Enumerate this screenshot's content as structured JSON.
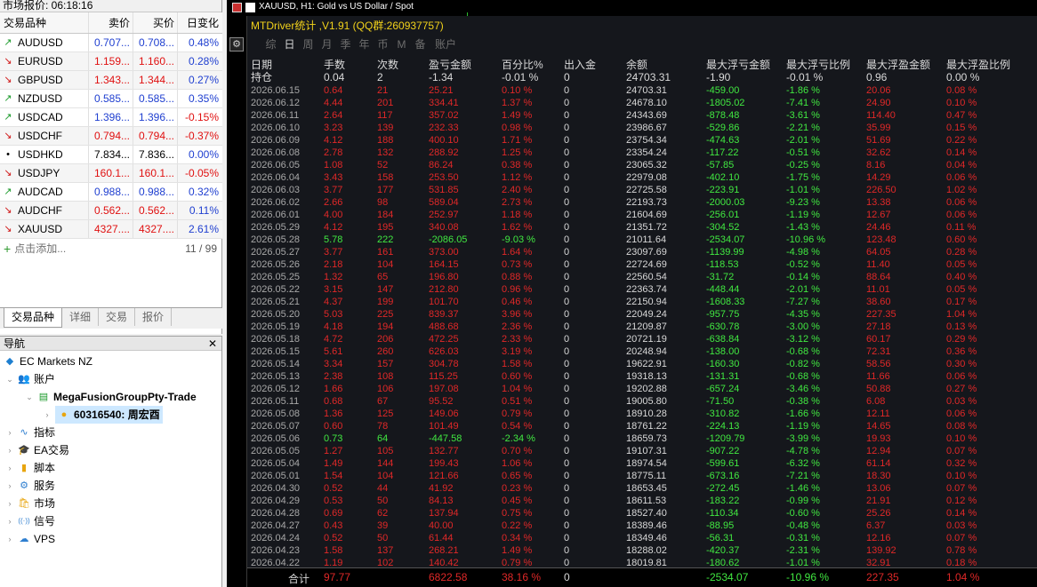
{
  "market_watch": {
    "title": "市场报价: 06:18:16",
    "headers": {
      "symbol": "交易品种",
      "bid": "卖价",
      "ask": "买价",
      "change": "日变化"
    },
    "rows": [
      {
        "symbol": "AUDUSD",
        "bid": "0.707...",
        "ask": "0.708...",
        "change": "0.48%",
        "dir": "up"
      },
      {
        "symbol": "EURUSD",
        "bid": "1.159...",
        "ask": "1.160...",
        "change": "0.28%",
        "dir": "down"
      },
      {
        "symbol": "GBPUSD",
        "bid": "1.343...",
        "ask": "1.344...",
        "change": "0.27%",
        "dir": "down"
      },
      {
        "symbol": "NZDUSD",
        "bid": "0.585...",
        "ask": "0.585...",
        "change": "0.35%",
        "dir": "up"
      },
      {
        "symbol": "USDCAD",
        "bid": "1.396...",
        "ask": "1.396...",
        "change": "-0.15%",
        "dir": "up"
      },
      {
        "symbol": "USDCHF",
        "bid": "0.794...",
        "ask": "0.794...",
        "change": "-0.37%",
        "dir": "down"
      },
      {
        "symbol": "USDHKD",
        "bid": "7.834...",
        "ask": "7.836...",
        "change": "0.00%",
        "dir": "none"
      },
      {
        "symbol": "USDJPY",
        "bid": "160.1...",
        "ask": "160.1...",
        "change": "-0.05%",
        "dir": "down"
      },
      {
        "symbol": "AUDCAD",
        "bid": "0.988...",
        "ask": "0.988...",
        "change": "0.32%",
        "dir": "up"
      },
      {
        "symbol": "AUDCHF",
        "bid": "0.562...",
        "ask": "0.562...",
        "change": "0.11%",
        "dir": "down"
      },
      {
        "symbol": "XAUUSD",
        "bid": "4327....",
        "ask": "4327....",
        "change": "2.61%",
        "dir": "down"
      }
    ],
    "add_label": "点击添加...",
    "count": "11 / 99",
    "tabs": [
      "交易品种",
      "详细",
      "交易",
      "报价"
    ]
  },
  "navigator": {
    "title": "导航",
    "broker": "EC Markets NZ",
    "accounts_label": "账户",
    "server": "MegaFusionGroupPty-Trade",
    "account": "60316540: 周宏酉",
    "items": [
      "指标",
      "EA交易",
      "脚本",
      "服务",
      "市场",
      "信号",
      "VPS"
    ]
  },
  "chart": {
    "header": "XAUUSD, H1:  Gold vs US Dollar / Spot",
    "panel_title": "MTDriver统计 ,V1.91 (QQ群:260937757)",
    "tabs": [
      "综",
      "日",
      "周",
      "月",
      "季",
      "年",
      "币",
      "M",
      "备",
      "账户"
    ],
    "active_tab": "日",
    "side_button": "⚙",
    "columns": [
      "日期",
      "手数",
      "次数",
      "盈亏金额",
      "百分比%",
      "出入金",
      "余额",
      "最大浮亏金额",
      "最大浮亏比例",
      "最大浮盈金额",
      "最大浮盈比例"
    ],
    "holding": {
      "date": "持仓",
      "lots": "0.04",
      "count": "2",
      "pnl": "-1.34",
      "pct": "-0.01 %",
      "flow": "0",
      "balance": "24703.31",
      "max_loss": "-1.90",
      "max_loss_pct": "-0.01 %",
      "max_profit": "0.96",
      "max_profit_pct": "0.00 %"
    },
    "rows": [
      {
        "date": "2026.06.15",
        "lots": "0.64",
        "count": "21",
        "pnl": "25.21",
        "pct": "0.10 %",
        "flow": "0",
        "balance": "24703.31",
        "max_loss": "-459.00",
        "max_loss_pct": "-1.86 %",
        "max_profit": "20.06",
        "max_profit_pct": "0.08 %"
      },
      {
        "date": "2026.06.12",
        "lots": "4.44",
        "count": "201",
        "pnl": "334.41",
        "pct": "1.37 %",
        "flow": "0",
        "balance": "24678.10",
        "max_loss": "-1805.02",
        "max_loss_pct": "-7.41 %",
        "max_profit": "24.90",
        "max_profit_pct": "0.10 %"
      },
      {
        "date": "2026.06.11",
        "lots": "2.64",
        "count": "117",
        "pnl": "357.02",
        "pct": "1.49 %",
        "flow": "0",
        "balance": "24343.69",
        "max_loss": "-878.48",
        "max_loss_pct": "-3.61 %",
        "max_profit": "114.40",
        "max_profit_pct": "0.47 %"
      },
      {
        "date": "2026.06.10",
        "lots": "3.23",
        "count": "139",
        "pnl": "232.33",
        "pct": "0.98 %",
        "flow": "0",
        "balance": "23986.67",
        "max_loss": "-529.86",
        "max_loss_pct": "-2.21 %",
        "max_profit": "35.99",
        "max_profit_pct": "0.15 %"
      },
      {
        "date": "2026.06.09",
        "lots": "4.12",
        "count": "188",
        "pnl": "400.10",
        "pct": "1.71 %",
        "flow": "0",
        "balance": "23754.34",
        "max_loss": "-474.63",
        "max_loss_pct": "-2.01 %",
        "max_profit": "51.69",
        "max_profit_pct": "0.22 %"
      },
      {
        "date": "2026.06.08",
        "lots": "2.78",
        "count": "132",
        "pnl": "288.92",
        "pct": "1.25 %",
        "flow": "0",
        "balance": "23354.24",
        "max_loss": "-117.22",
        "max_loss_pct": "-0.51 %",
        "max_profit": "32.62",
        "max_profit_pct": "0.14 %"
      },
      {
        "date": "2026.06.05",
        "lots": "1.08",
        "count": "52",
        "pnl": "86.24",
        "pct": "0.38 %",
        "flow": "0",
        "balance": "23065.32",
        "max_loss": "-57.85",
        "max_loss_pct": "-0.25 %",
        "max_profit": "8.16",
        "max_profit_pct": "0.04 %"
      },
      {
        "date": "2026.06.04",
        "lots": "3.43",
        "count": "158",
        "pnl": "253.50",
        "pct": "1.12 %",
        "flow": "0",
        "balance": "22979.08",
        "max_loss": "-402.10",
        "max_loss_pct": "-1.75 %",
        "max_profit": "14.29",
        "max_profit_pct": "0.06 %"
      },
      {
        "date": "2026.06.03",
        "lots": "3.77",
        "count": "177",
        "pnl": "531.85",
        "pct": "2.40 %",
        "flow": "0",
        "balance": "22725.58",
        "max_loss": "-223.91",
        "max_loss_pct": "-1.01 %",
        "max_profit": "226.50",
        "max_profit_pct": "1.02 %"
      },
      {
        "date": "2026.06.02",
        "lots": "2.66",
        "count": "98",
        "pnl": "589.04",
        "pct": "2.73 %",
        "flow": "0",
        "balance": "22193.73",
        "max_loss": "-2000.03",
        "max_loss_pct": "-9.23 %",
        "max_profit": "13.38",
        "max_profit_pct": "0.06 %"
      },
      {
        "date": "2026.06.01",
        "lots": "4.00",
        "count": "184",
        "pnl": "252.97",
        "pct": "1.18 %",
        "flow": "0",
        "balance": "21604.69",
        "max_loss": "-256.01",
        "max_loss_pct": "-1.19 %",
        "max_profit": "12.67",
        "max_profit_pct": "0.06 %"
      },
      {
        "date": "2026.05.29",
        "lots": "4.12",
        "count": "195",
        "pnl": "340.08",
        "pct": "1.62 %",
        "flow": "0",
        "balance": "21351.72",
        "max_loss": "-304.52",
        "max_loss_pct": "-1.43 %",
        "max_profit": "24.46",
        "max_profit_pct": "0.11 %"
      },
      {
        "date": "2026.05.28",
        "lots": "5.78",
        "count": "222",
        "pnl": "-2086.05",
        "pct": "-9.03 %",
        "flow": "0",
        "balance": "21011.64",
        "max_loss": "-2534.07",
        "max_loss_pct": "-10.96 %",
        "max_profit": "123.48",
        "max_profit_pct": "0.60 %"
      },
      {
        "date": "2026.05.27",
        "lots": "3.77",
        "count": "161",
        "pnl": "373.00",
        "pct": "1.64 %",
        "flow": "0",
        "balance": "23097.69",
        "max_loss": "-1139.99",
        "max_loss_pct": "-4.98 %",
        "max_profit": "64.05",
        "max_profit_pct": "0.28 %"
      },
      {
        "date": "2026.05.26",
        "lots": "2.18",
        "count": "104",
        "pnl": "164.15",
        "pct": "0.73 %",
        "flow": "0",
        "balance": "22724.69",
        "max_loss": "-118.53",
        "max_loss_pct": "-0.52 %",
        "max_profit": "11.40",
        "max_profit_pct": "0.05 %"
      },
      {
        "date": "2026.05.25",
        "lots": "1.32",
        "count": "65",
        "pnl": "196.80",
        "pct": "0.88 %",
        "flow": "0",
        "balance": "22560.54",
        "max_loss": "-31.72",
        "max_loss_pct": "-0.14 %",
        "max_profit": "88.64",
        "max_profit_pct": "0.40 %"
      },
      {
        "date": "2026.05.22",
        "lots": "3.15",
        "count": "147",
        "pnl": "212.80",
        "pct": "0.96 %",
        "flow": "0",
        "balance": "22363.74",
        "max_loss": "-448.44",
        "max_loss_pct": "-2.01 %",
        "max_profit": "11.01",
        "max_profit_pct": "0.05 %"
      },
      {
        "date": "2026.05.21",
        "lots": "4.37",
        "count": "199",
        "pnl": "101.70",
        "pct": "0.46 %",
        "flow": "0",
        "balance": "22150.94",
        "max_loss": "-1608.33",
        "max_loss_pct": "-7.27 %",
        "max_profit": "38.60",
        "max_profit_pct": "0.17 %"
      },
      {
        "date": "2026.05.20",
        "lots": "5.03",
        "count": "225",
        "pnl": "839.37",
        "pct": "3.96 %",
        "flow": "0",
        "balance": "22049.24",
        "max_loss": "-957.75",
        "max_loss_pct": "-4.35 %",
        "max_profit": "227.35",
        "max_profit_pct": "1.04 %"
      },
      {
        "date": "2026.05.19",
        "lots": "4.18",
        "count": "194",
        "pnl": "488.68",
        "pct": "2.36 %",
        "flow": "0",
        "balance": "21209.87",
        "max_loss": "-630.78",
        "max_loss_pct": "-3.00 %",
        "max_profit": "27.18",
        "max_profit_pct": "0.13 %"
      },
      {
        "date": "2026.05.18",
        "lots": "4.72",
        "count": "206",
        "pnl": "472.25",
        "pct": "2.33 %",
        "flow": "0",
        "balance": "20721.19",
        "max_loss": "-638.84",
        "max_loss_pct": "-3.12 %",
        "max_profit": "60.17",
        "max_profit_pct": "0.29 %"
      },
      {
        "date": "2026.05.15",
        "lots": "5.61",
        "count": "260",
        "pnl": "626.03",
        "pct": "3.19 %",
        "flow": "0",
        "balance": "20248.94",
        "max_loss": "-138.00",
        "max_loss_pct": "-0.68 %",
        "max_profit": "72.31",
        "max_profit_pct": "0.36 %"
      },
      {
        "date": "2026.05.14",
        "lots": "3.34",
        "count": "157",
        "pnl": "304.78",
        "pct": "1.58 %",
        "flow": "0",
        "balance": "19622.91",
        "max_loss": "-160.30",
        "max_loss_pct": "-0.82 %",
        "max_profit": "58.56",
        "max_profit_pct": "0.30 %"
      },
      {
        "date": "2026.05.13",
        "lots": "2.38",
        "count": "108",
        "pnl": "115.25",
        "pct": "0.60 %",
        "flow": "0",
        "balance": "19318.13",
        "max_loss": "-131.31",
        "max_loss_pct": "-0.68 %",
        "max_profit": "11.66",
        "max_profit_pct": "0.06 %"
      },
      {
        "date": "2026.05.12",
        "lots": "1.66",
        "count": "106",
        "pnl": "197.08",
        "pct": "1.04 %",
        "flow": "0",
        "balance": "19202.88",
        "max_loss": "-657.24",
        "max_loss_pct": "-3.46 %",
        "max_profit": "50.88",
        "max_profit_pct": "0.27 %"
      },
      {
        "date": "2026.05.11",
        "lots": "0.68",
        "count": "67",
        "pnl": "95.52",
        "pct": "0.51 %",
        "flow": "0",
        "balance": "19005.80",
        "max_loss": "-71.50",
        "max_loss_pct": "-0.38 %",
        "max_profit": "6.08",
        "max_profit_pct": "0.03 %"
      },
      {
        "date": "2026.05.08",
        "lots": "1.36",
        "count": "125",
        "pnl": "149.06",
        "pct": "0.79 %",
        "flow": "0",
        "balance": "18910.28",
        "max_loss": "-310.82",
        "max_loss_pct": "-1.66 %",
        "max_profit": "12.11",
        "max_profit_pct": "0.06 %"
      },
      {
        "date": "2026.05.07",
        "lots": "0.60",
        "count": "78",
        "pnl": "101.49",
        "pct": "0.54 %",
        "flow": "0",
        "balance": "18761.22",
        "max_loss": "-224.13",
        "max_loss_pct": "-1.19 %",
        "max_profit": "14.65",
        "max_profit_pct": "0.08 %"
      },
      {
        "date": "2026.05.06",
        "lots": "0.73",
        "count": "64",
        "pnl": "-447.58",
        "pct": "-2.34 %",
        "flow": "0",
        "balance": "18659.73",
        "max_loss": "-1209.79",
        "max_loss_pct": "-3.99 %",
        "max_profit": "19.93",
        "max_profit_pct": "0.10 %"
      },
      {
        "date": "2026.05.05",
        "lots": "1.27",
        "count": "105",
        "pnl": "132.77",
        "pct": "0.70 %",
        "flow": "0",
        "balance": "19107.31",
        "max_loss": "-907.22",
        "max_loss_pct": "-4.78 %",
        "max_profit": "12.94",
        "max_profit_pct": "0.07 %"
      },
      {
        "date": "2026.05.04",
        "lots": "1.49",
        "count": "144",
        "pnl": "199.43",
        "pct": "1.06 %",
        "flow": "0",
        "balance": "18974.54",
        "max_loss": "-599.61",
        "max_loss_pct": "-6.32 %",
        "max_profit": "61.14",
        "max_profit_pct": "0.32 %"
      },
      {
        "date": "2026.05.01",
        "lots": "1.54",
        "count": "104",
        "pnl": "121.66",
        "pct": "0.65 %",
        "flow": "0",
        "balance": "18775.11",
        "max_loss": "-673.16",
        "max_loss_pct": "-7.21 %",
        "max_profit": "18.30",
        "max_profit_pct": "0.10 %"
      },
      {
        "date": "2026.04.30",
        "lots": "0.52",
        "count": "44",
        "pnl": "41.92",
        "pct": "0.23 %",
        "flow": "0",
        "balance": "18653.45",
        "max_loss": "-272.45",
        "max_loss_pct": "-1.46 %",
        "max_profit": "13.06",
        "max_profit_pct": "0.07 %"
      },
      {
        "date": "2026.04.29",
        "lots": "0.53",
        "count": "50",
        "pnl": "84.13",
        "pct": "0.45 %",
        "flow": "0",
        "balance": "18611.53",
        "max_loss": "-183.22",
        "max_loss_pct": "-0.99 %",
        "max_profit": "21.91",
        "max_profit_pct": "0.12 %"
      },
      {
        "date": "2026.04.28",
        "lots": "0.69",
        "count": "62",
        "pnl": "137.94",
        "pct": "0.75 %",
        "flow": "0",
        "balance": "18527.40",
        "max_loss": "-110.34",
        "max_loss_pct": "-0.60 %",
        "max_profit": "25.26",
        "max_profit_pct": "0.14 %"
      },
      {
        "date": "2026.04.27",
        "lots": "0.43",
        "count": "39",
        "pnl": "40.00",
        "pct": "0.22 %",
        "flow": "0",
        "balance": "18389.46",
        "max_loss": "-88.95",
        "max_loss_pct": "-0.48 %",
        "max_profit": "6.37",
        "max_profit_pct": "0.03 %"
      },
      {
        "date": "2026.04.24",
        "lots": "0.52",
        "count": "50",
        "pnl": "61.44",
        "pct": "0.34 %",
        "flow": "0",
        "balance": "18349.46",
        "max_loss": "-56.31",
        "max_loss_pct": "-0.31 %",
        "max_profit": "12.16",
        "max_profit_pct": "0.07 %"
      },
      {
        "date": "2026.04.23",
        "lots": "1.58",
        "count": "137",
        "pnl": "268.21",
        "pct": "1.49 %",
        "flow": "0",
        "balance": "18288.02",
        "max_loss": "-420.37",
        "max_loss_pct": "-2.31 %",
        "max_profit": "139.92",
        "max_profit_pct": "0.78 %"
      },
      {
        "date": "2026.04.22",
        "lots": "1.19",
        "count": "102",
        "pnl": "140.42",
        "pct": "0.79 %",
        "flow": "0",
        "balance": "18019.81",
        "max_loss": "-180.62",
        "max_loss_pct": "-1.01 %",
        "max_profit": "32.91",
        "max_profit_pct": "0.18 %"
      }
    ],
    "total": {
      "label": "合计",
      "lots": "97.77",
      "pnl": "6822.58",
      "pct": "38.16 %",
      "flow": "0",
      "max_loss": "-2534.07",
      "max_loss_pct": "-10.96 %",
      "max_profit": "227.35",
      "max_profit_pct": "1.04 %"
    }
  }
}
